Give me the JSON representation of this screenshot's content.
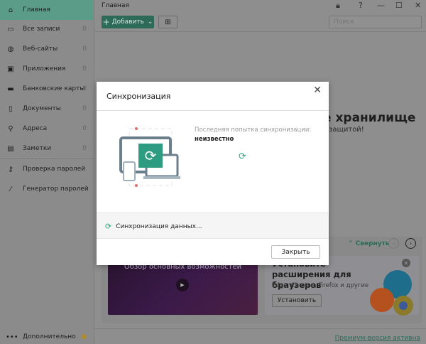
{
  "sidebar": {
    "items": [
      {
        "label": "Главная",
        "count": "",
        "icon": "home-icon"
      },
      {
        "label": "Все записи",
        "count": "0",
        "icon": "folder-icon"
      },
      {
        "label": "Веб-сайты",
        "count": "0",
        "icon": "globe-icon"
      },
      {
        "label": "Приложения",
        "count": "0",
        "icon": "apps-icon"
      },
      {
        "label": "Банковские карты",
        "count": "0",
        "icon": "card-icon"
      },
      {
        "label": "Документы",
        "count": "0",
        "icon": "document-icon"
      },
      {
        "label": "Адреса",
        "count": "0",
        "icon": "location-icon"
      },
      {
        "label": "Заметки",
        "count": "0",
        "icon": "notes-icon"
      }
    ],
    "tools": [
      {
        "label": "Проверка паролей",
        "icon": "key-icon"
      },
      {
        "label": "Генератор паролей",
        "icon": "wand-icon"
      }
    ],
    "more": "Дополнительно"
  },
  "header": {
    "breadcrumb": "Главная",
    "add_label": "Добавить",
    "search_placeholder": "Поиск"
  },
  "background": {
    "title_fragment": "е хранилище",
    "subtitle_fragment": "защитой!"
  },
  "promo": {
    "collapse": "Свернуть",
    "video_title": "Обзор основных возможностей",
    "ext_title": "Установите расширения для браузеров",
    "ext_sub": "Edge, Chrome, Firefox и другие",
    "install": "Установить"
  },
  "footer": {
    "premium": "Премиум-версия активна"
  },
  "modal": {
    "title": "Синхронизация",
    "last_attempt_label": "Последняя попытка синхронизации:",
    "last_attempt_value": "неизвестно",
    "status": "Синхронизация данных...",
    "close_button": "Закрыть"
  },
  "colors": {
    "accent": "#29a37e",
    "dark_accent": "#2e6a58"
  }
}
